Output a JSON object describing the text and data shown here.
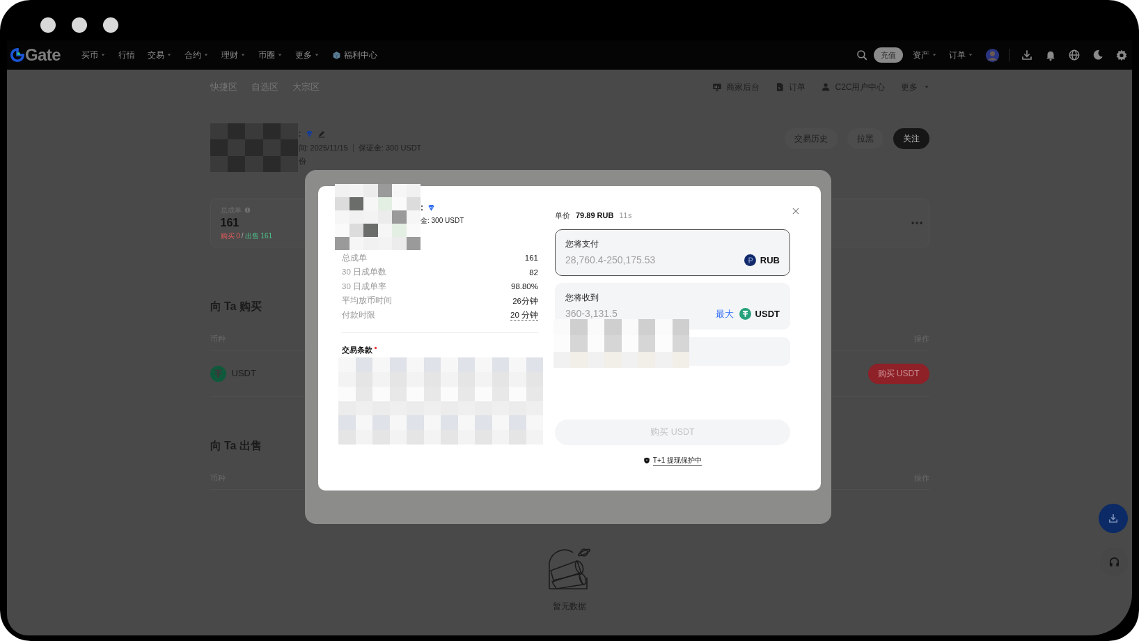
{
  "nav": {
    "logo": "Gate",
    "menu": [
      {
        "label": "买币",
        "dropdown": true
      },
      {
        "label": "行情",
        "dropdown": false
      },
      {
        "label": "交易",
        "dropdown": true
      },
      {
        "label": "合约",
        "dropdown": true
      },
      {
        "label": "理财",
        "dropdown": true
      },
      {
        "label": "币圈",
        "dropdown": true
      },
      {
        "label": "更多",
        "dropdown": true
      }
    ],
    "promo": "福利中心",
    "deposit": "充值",
    "right_menu": [
      {
        "label": "资产",
        "dropdown": true
      },
      {
        "label": "订单",
        "dropdown": true
      }
    ]
  },
  "subnav": {
    "zones": [
      "快捷区",
      "自选区",
      "大宗区"
    ],
    "links": [
      {
        "label": "商家后台",
        "dropdown": false
      },
      {
        "label": "订单",
        "dropdown": false
      },
      {
        "label": "C2C用户中心",
        "dropdown": false
      },
      {
        "label": "更多",
        "dropdown": true
      }
    ]
  },
  "merchant": {
    "name_tail": ":",
    "verified": true,
    "time": "间: 2025/11/15",
    "deposit": "保证金: 300 USDT",
    "line3": "份",
    "actions": [
      {
        "label": "交易历史",
        "primary": false
      },
      {
        "label": "拉黑",
        "primary": false
      },
      {
        "label": "关注",
        "primary": true
      }
    ]
  },
  "stats_card": {
    "label": "总成单",
    "value": "161",
    "buy": "购买 0",
    "separator": "/",
    "sell": "出售 161"
  },
  "buy_section": {
    "title": "向 Ta 购买",
    "columns": [
      "币种",
      "操作"
    ],
    "rows": [
      {
        "coin": "USDT",
        "action": "购买 USDT"
      }
    ]
  },
  "sell_section": {
    "title": "向 Ta 出售",
    "columns": [
      "币种",
      "操作"
    ],
    "empty": "暂无数据"
  },
  "modal": {
    "name_tail": ":",
    "verified": true,
    "deposit_tail": "金: 300 USDT",
    "stats": [
      {
        "label": "总成单",
        "value": "161",
        "underlined": false
      },
      {
        "label": "30 日成单数",
        "value": "82",
        "underlined": false
      },
      {
        "label": "30 日成单率",
        "value": "98.80%",
        "underlined": false
      },
      {
        "label": "平均放币时间",
        "value": "26分钟",
        "underlined": false
      },
      {
        "label": "付款时限",
        "value": "20 分钟",
        "underlined": true
      }
    ],
    "terms_label": "交易条款",
    "terms_required": true,
    "price_label": "单价",
    "price": "79.89 RUB",
    "countdown": "11s",
    "pay": {
      "label": "您将支付",
      "placeholder": "28,760.4-250,175.53",
      "currency": "RUB",
      "focused": true
    },
    "receive": {
      "label": "您将收到",
      "placeholder": "360-3,131.5",
      "max": "最大",
      "currency": "USDT",
      "focused": false
    },
    "submit": {
      "label": "购买 USDT",
      "disabled": true
    },
    "protection": "T+1 提现保护中"
  }
}
